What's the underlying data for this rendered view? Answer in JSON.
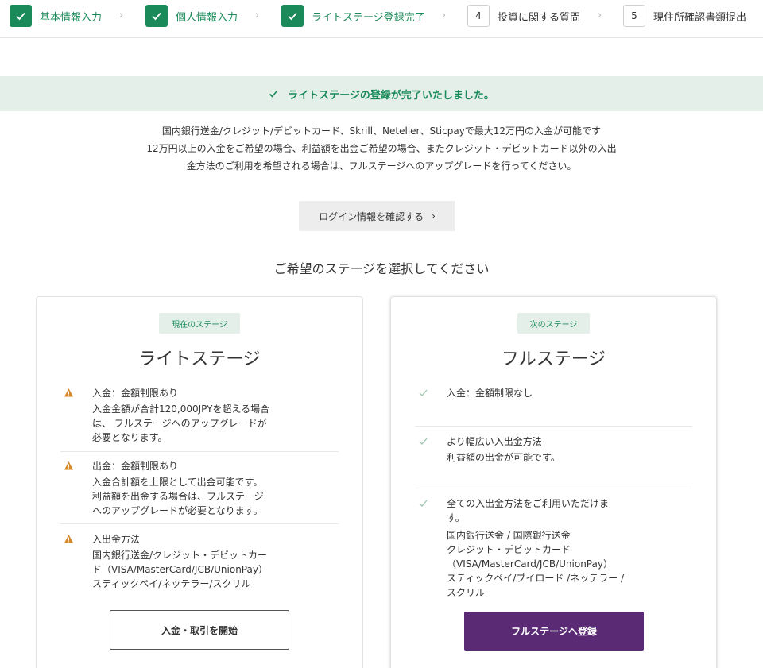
{
  "stepper": {
    "steps": [
      {
        "label": "基本情報入力",
        "status": "done",
        "number": ""
      },
      {
        "label": "個人情報入力",
        "status": "done",
        "number": ""
      },
      {
        "label": "ライトステージ登録完了",
        "status": "done",
        "number": ""
      },
      {
        "label": "投資に関する質問",
        "status": "todo",
        "number": "4"
      },
      {
        "label": "現住所確認書類提出",
        "status": "todo",
        "number": "5"
      }
    ],
    "chevron": "›"
  },
  "banner": {
    "text": "ライトステージの登録が完了いたしました。",
    "icon": "check-icon"
  },
  "description": {
    "line1": "国内銀行送金/クレジット/デビットカード、Skrill、Neteller、Sticpayで最大12万円の入金が可能です",
    "line2": "12万円以上の入金をご希望の場合、利益額を出金ご希望の場合、またクレジット・デビットカード以外の入出",
    "line3": "金方法のご利用を希望される場合は、フルステージへのアップグレードを行ってください。"
  },
  "login_button": {
    "label": "ログイン情報を確認する",
    "chevron": "›"
  },
  "section_title": "ご希望のステージを選択してください",
  "cards": {
    "current": {
      "badge": "現在のステージ",
      "title": "ライトステージ",
      "features": [
        {
          "title": "入金：金額制限あり",
          "lines": [
            "入金金額が合計120,000JPYを超える場合",
            "は、 フルステージへのアップグレードが",
            "必要となります。"
          ],
          "icon": "warning-icon"
        },
        {
          "title": "出金：金額制限あり",
          "lines": [
            "入金合計額を上限として出金可能です。",
            "利益額を出金する場合は、フルステージ",
            "へのアップグレードが必要となります。"
          ],
          "icon": "warning-icon"
        },
        {
          "title": "入出金方法",
          "lines": [
            "国内銀行送金/クレジット・デビットカー",
            "ド（VISA/MasterCard/JCB/UnionPay）",
            "スティックペイ/ネッテラー/スクリル"
          ],
          "icon": "warning-icon"
        }
      ],
      "button": "入金・取引を開始"
    },
    "next": {
      "badge": "次のステージ",
      "title": "フルステージ",
      "features": [
        {
          "title": "入金：金額制限なし",
          "lines": [],
          "icon": "check-icon"
        },
        {
          "title": "より幅広い入出金方法",
          "lines": [
            "利益額の出金が可能です。"
          ],
          "icon": "check-icon"
        },
        {
          "title": "全ての入出金方法をご利用いただけま",
          "lines": [
            "す。",
            "国内銀行送金 / 国際銀行送金",
            "クレジット・デビットカード",
            "（VISA/MasterCard/JCB/UnionPay）",
            "スティックペイ/ブイロード /ネッテラー /",
            "スクリル"
          ],
          "icon": "check-icon"
        }
      ],
      "button": "フルステージへ登録"
    }
  },
  "colors": {
    "accent_green": "#1a8a5a",
    "banner_bg": "#e4efe9",
    "warning": "#d28a2a",
    "primary_purple": "#5a2a74"
  }
}
